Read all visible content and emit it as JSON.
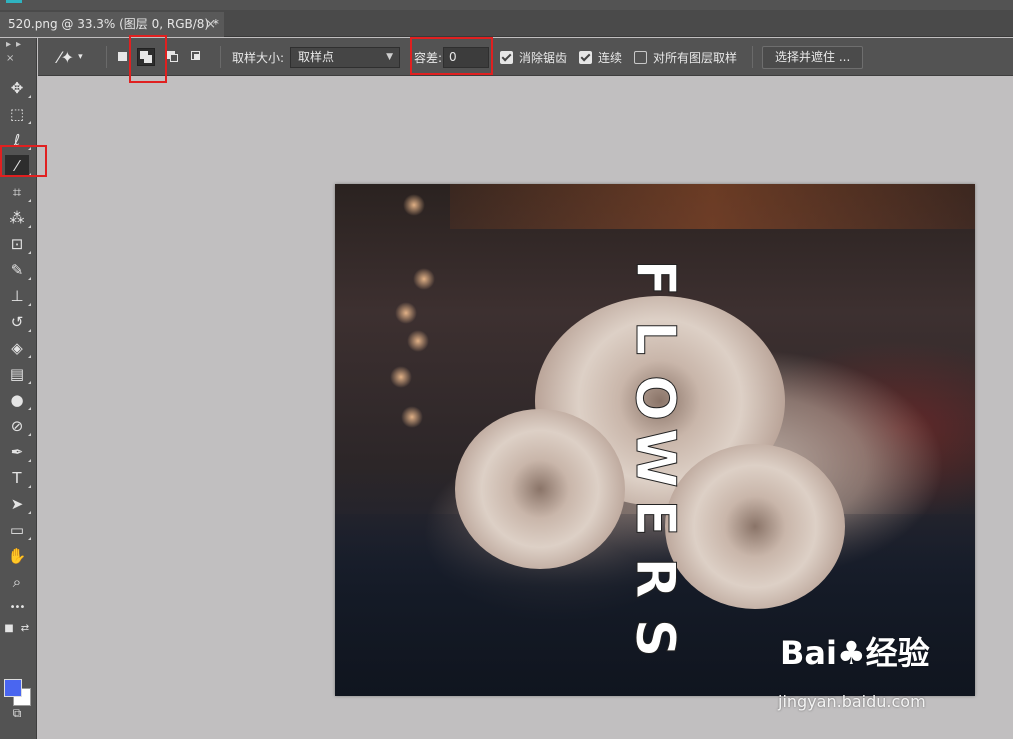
{
  "document": {
    "tab_title": "520.png @ 33.3% (图层 0, RGB/8) *",
    "close_glyph": "×"
  },
  "toolbar_header": "▸▸ ×",
  "options_bar": {
    "tool_icon": "magic-wand-icon",
    "selection_modes": [
      "new-selection",
      "add-to-selection",
      "subtract-from-selection",
      "intersect-with-selection"
    ],
    "active_mode": "add-to-selection",
    "sample_size_label": "取样大小:",
    "sample_size_value": "取样点",
    "tolerance_label": "容差:",
    "tolerance_value": "0",
    "anti_alias_label": "消除锯齿",
    "anti_alias_checked": true,
    "contiguous_label": "连续",
    "contiguous_checked": true,
    "sample_all_layers_label": "对所有图层取样",
    "sample_all_layers_checked": false,
    "select_and_mask_label": "选择并遮住 ..."
  },
  "tools": [
    {
      "name": "move-tool",
      "icon": "move-icon",
      "glyph": "✥"
    },
    {
      "name": "marquee-tool",
      "icon": "rectangular-marquee-icon",
      "glyph": "⬚"
    },
    {
      "name": "lasso-tool",
      "icon": "lasso-icon",
      "glyph": "ℓ"
    },
    {
      "name": "magic-wand-tool",
      "icon": "magic-wand-icon",
      "glyph": "⁄",
      "active": true
    },
    {
      "name": "crop-tool",
      "icon": "crop-icon",
      "glyph": "⌗"
    },
    {
      "name": "eyedropper-tool",
      "icon": "eyedropper-icon",
      "glyph": "⁂"
    },
    {
      "name": "healing-tool",
      "icon": "healing-brush-icon",
      "glyph": "⊡"
    },
    {
      "name": "brush-tool",
      "icon": "brush-icon",
      "glyph": "✎"
    },
    {
      "name": "stamp-tool",
      "icon": "clone-stamp-icon",
      "glyph": "⊥"
    },
    {
      "name": "history-brush-tool",
      "icon": "history-brush-icon",
      "glyph": "↺"
    },
    {
      "name": "eraser-tool",
      "icon": "eraser-icon",
      "glyph": "◈"
    },
    {
      "name": "gradient-tool",
      "icon": "gradient-icon",
      "glyph": "▤"
    },
    {
      "name": "blur-tool",
      "icon": "blur-icon",
      "glyph": "●"
    },
    {
      "name": "dodge-tool",
      "icon": "dodge-icon",
      "glyph": "⊘"
    },
    {
      "name": "pen-tool",
      "icon": "pen-icon",
      "glyph": "✒"
    },
    {
      "name": "type-tool",
      "icon": "type-icon",
      "glyph": "T"
    },
    {
      "name": "path-select-tool",
      "icon": "arrow-icon",
      "glyph": "➤"
    },
    {
      "name": "shape-tool",
      "icon": "rectangle-icon",
      "glyph": "▭"
    },
    {
      "name": "hand-tool",
      "icon": "hand-icon",
      "glyph": "✋"
    },
    {
      "name": "zoom-tool",
      "icon": "zoom-icon",
      "glyph": "⌕"
    },
    {
      "name": "more-tools",
      "icon": "more-icon",
      "glyph": "•••"
    }
  ],
  "colors": {
    "foreground": "#4a66f0",
    "background": "#ffffff",
    "highlight": "#e02020"
  },
  "canvas_text": {
    "letters": [
      "F",
      "L",
      "O",
      "W",
      "E",
      "R",
      "S"
    ]
  },
  "watermark": {
    "brand": "Bai♣经验",
    "url": "jingyan.baidu.com"
  }
}
